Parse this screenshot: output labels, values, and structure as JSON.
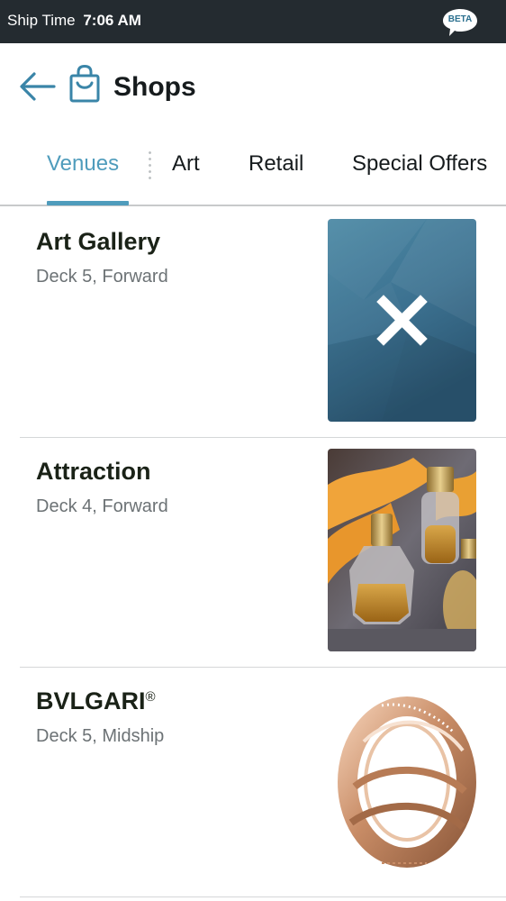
{
  "status_bar": {
    "label": "Ship Time",
    "time": "7:06 AM",
    "beta_badge": "BETA"
  },
  "header": {
    "back_icon": "arrow-left-icon",
    "bag_icon": "shopping-bag-icon",
    "title": "Shops"
  },
  "tabs": [
    {
      "label": "Venues",
      "active": true
    },
    {
      "label": "Art",
      "active": false
    },
    {
      "label": "Retail",
      "active": false
    },
    {
      "label": "Special Offers",
      "active": false
    }
  ],
  "venues": [
    {
      "name": "Art Gallery",
      "trademark": "",
      "location": "Deck 5, Forward",
      "thumbnail": "placeholder-x-icon"
    },
    {
      "name": "Attraction",
      "trademark": "",
      "location": "Deck 4, Forward",
      "thumbnail": "perfume-bottles-photo"
    },
    {
      "name": "BVLGARI",
      "trademark": "®",
      "location": "Deck 5, Midship",
      "thumbnail": "gold-ring-photo"
    }
  ],
  "colors": {
    "accent": "#4f9cbc",
    "status_bar": "#242b30",
    "placeholder_tile": "#3a6f8a"
  }
}
